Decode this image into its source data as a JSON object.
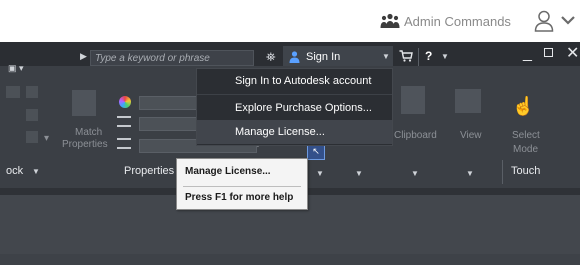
{
  "top_bar": {
    "admin_label": "Admin Commands",
    "user_icon": "person-outline-icon",
    "chevron_icon": "chevron-down-icon"
  },
  "title_bar": {
    "search_placeholder": "Type a keyword or phrase",
    "sign_in_label": "Sign In",
    "icons": [
      "search-arrow-icon",
      "binoculars-icon",
      "person-icon",
      "cart-icon",
      "help-icon",
      "minimize-icon",
      "maximize-icon",
      "close-icon"
    ]
  },
  "ribbon": {
    "match_properties_line1": "Match",
    "match_properties_line2": "Properties",
    "properties_panel_label": "Properties",
    "dock_label": "ock",
    "clipboard_label": "Clipboard",
    "view_label": "View",
    "select_mode_line1": "Select",
    "select_mode_line2": "Mode",
    "touch_label": "Touch"
  },
  "signin_menu": {
    "items": [
      "Sign In to Autodesk account",
      "Explore Purchase Options...",
      "Manage License..."
    ],
    "highlighted_index": 2
  },
  "tooltip": {
    "title": "Manage License...",
    "help_text": "Press F1 for more help"
  }
}
